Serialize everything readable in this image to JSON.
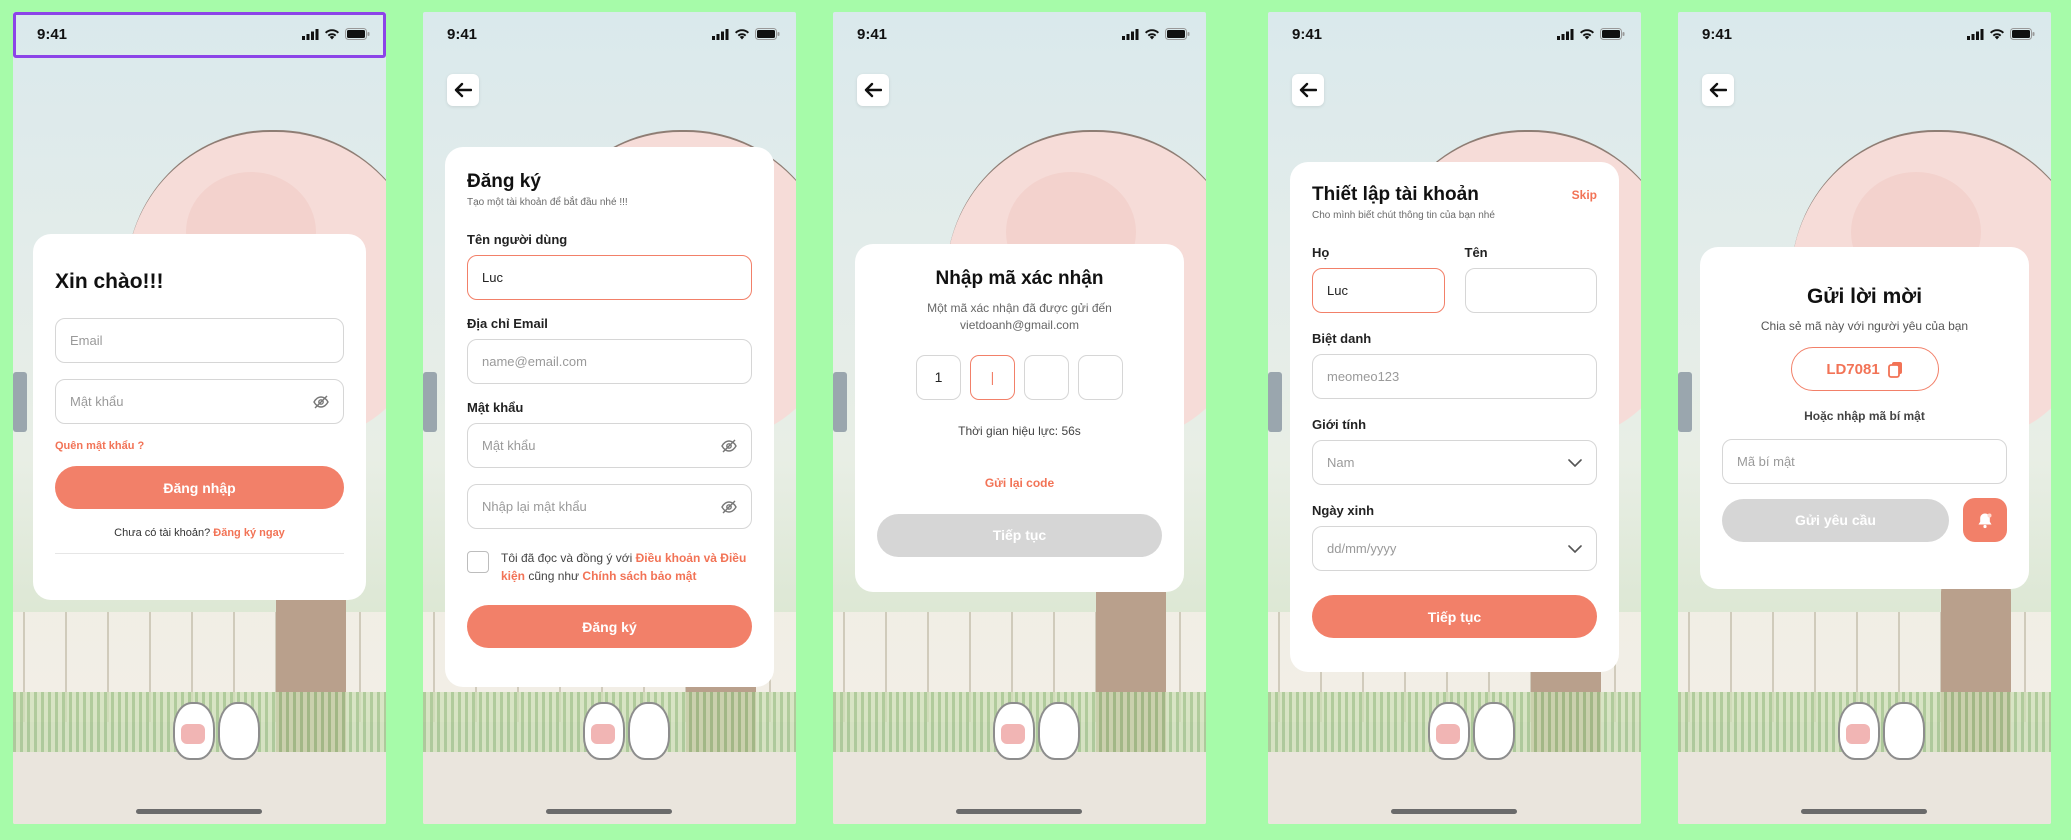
{
  "status": {
    "time": "9:41"
  },
  "colors": {
    "accent": "#f28069",
    "background": "#a6fba9",
    "selection": "#8c44e8"
  },
  "screen1": {
    "title": "Xin chào!!!",
    "email_placeholder": "Email",
    "password_placeholder": "Mật khẩu",
    "forgot": "Quên mật khẩu ?",
    "login_button": "Đăng nhập",
    "no_account": "Chưa có tài khoản?",
    "register_link": "Đăng ký ngay"
  },
  "screen2": {
    "title": "Đăng ký",
    "subtitle": "Tạo một tài khoản để bắt đầu nhé !!!",
    "username_label": "Tên người dùng",
    "username_value": "Luc",
    "email_label": "Địa chỉ Email",
    "email_placeholder": "name@email.com",
    "password_label": "Mật khẩu",
    "password_placeholder": "Mật khẩu",
    "confirm_placeholder": "Nhập lại mật khẩu",
    "terms_prefix": "Tôi đã đọc và đồng ý với ",
    "terms_link": "Điều khoản và Điều kiện",
    "terms_middle": " cũng như ",
    "privacy_link": "Chính sách bảo mật",
    "register_button": "Đăng ký"
  },
  "screen3": {
    "title": "Nhập mã xác nhận",
    "description_line1": "Một mã xác nhận đã được gửi đến",
    "description_line2": "vietdoanh@gmail.com",
    "otp": [
      "1",
      "|",
      "",
      ""
    ],
    "timer": "Thời gian hiệu lực: 56s",
    "resend": "Gửi lại code",
    "continue_button": "Tiếp tục"
  },
  "screen4": {
    "title": "Thiết lập tài khoản",
    "skip": "Skip",
    "subtitle": "Cho mình biết chút thông tin của bạn nhé",
    "last_name_label": "Họ",
    "last_name_value": "Luc",
    "first_name_label": "Tên",
    "nickname_label": "Biệt danh",
    "nickname_placeholder": "meomeo123",
    "gender_label": "Giới tính",
    "gender_value": "Nam",
    "dob_label": "Ngày xinh",
    "dob_placeholder": "dd/mm/yyyy",
    "continue_button": "Tiếp tục"
  },
  "screen5": {
    "title": "Gửi lời mời",
    "subtitle": "Chia sẻ mã này với người yêu của bạn",
    "code": "LD7081",
    "or_text": "Hoặc nhập mã bí mật",
    "secret_placeholder": "Mã bí mật",
    "send_button": "Gửi yêu cầu"
  }
}
